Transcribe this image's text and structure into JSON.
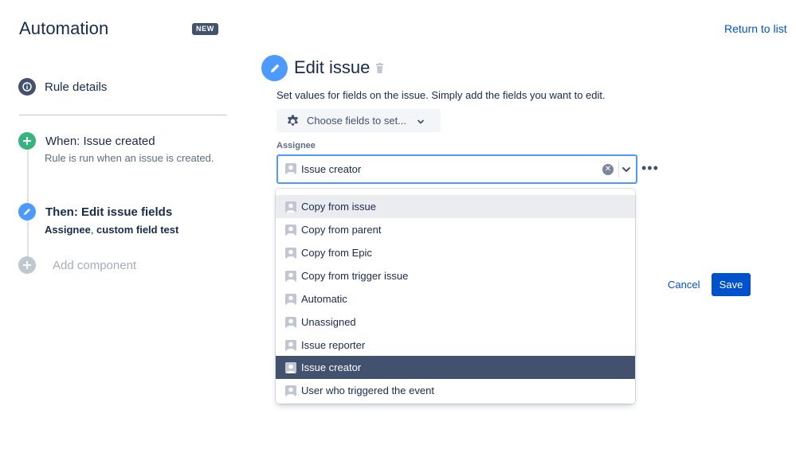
{
  "header": {
    "title": "Automation",
    "badge": "NEW",
    "return_link": "Return to list"
  },
  "rule": {
    "details_label": "Rule details",
    "trigger": {
      "title": "When: Issue created",
      "description": "Rule is run when an issue is created."
    },
    "action": {
      "title": "Then: Edit issue fields",
      "fields_bold_1": "Assignee",
      "fields_sep": ", ",
      "fields_bold_2": "custom field test"
    },
    "add_component": "Add component"
  },
  "editor": {
    "title": "Edit issue",
    "description": "Set values for fields on the issue. Simply add the fields you want to edit.",
    "choose_fields": "Choose fields to set...",
    "field_label": "Assignee",
    "selected_value": "Issue creator",
    "options": [
      "Copy from issue",
      "Copy from parent",
      "Copy from Epic",
      "Copy from trigger issue",
      "Automatic",
      "Unassigned",
      "Issue reporter",
      "Issue creator",
      "User who triggered the event"
    ],
    "hovered_option": "Copy from issue"
  },
  "footer": {
    "cancel": "Cancel",
    "save": "Save"
  },
  "colors": {
    "primary": "#0052cc",
    "selected_item": "#42526e",
    "trigger_icon": "#36b37e",
    "action_icon": "#4c9aff",
    "focus_border": "#4c9aff"
  },
  "icons": [
    "info-icon",
    "plus-icon",
    "pencil-icon",
    "trash-icon",
    "gear-icon",
    "chevron-down-icon",
    "clear-icon",
    "more-icon",
    "user-avatar-icon"
  ]
}
